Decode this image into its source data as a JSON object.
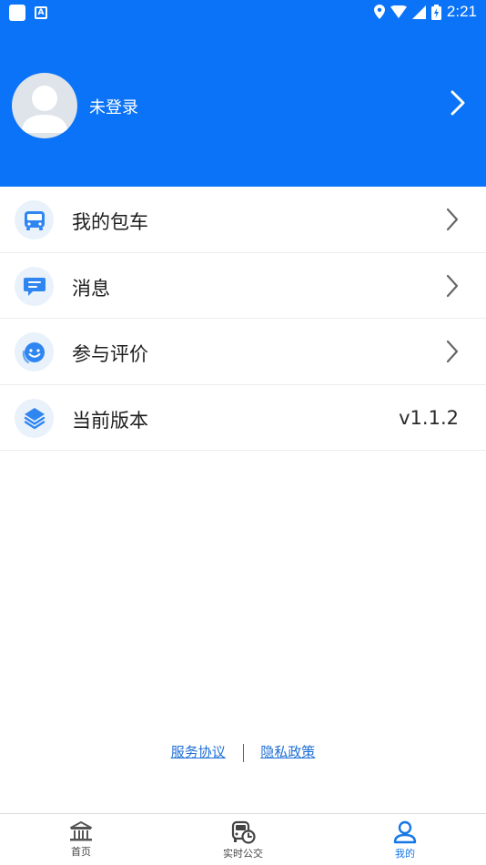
{
  "status_bar": {
    "time": "2:21"
  },
  "profile": {
    "username": "未登录"
  },
  "menu": {
    "items": [
      {
        "label": "我的包车",
        "icon": "bus-icon"
      },
      {
        "label": "消息",
        "icon": "message-icon"
      },
      {
        "label": "参与评价",
        "icon": "smiley-icon"
      },
      {
        "label": "当前版本",
        "icon": "layers-icon",
        "value": "v1.1.2"
      }
    ]
  },
  "links": {
    "service": "服务协议",
    "privacy": "隐私政策"
  },
  "tabbar": {
    "tabs": [
      {
        "label": "首页",
        "icon": "home-icon"
      },
      {
        "label": "实时公交",
        "icon": "realtime-bus-icon"
      },
      {
        "label": "我的",
        "icon": "user-icon",
        "active": true
      }
    ]
  },
  "colors": {
    "primary": "#0a73f7",
    "link": "#1d6fd6",
    "active_tab": "#1677e8"
  }
}
